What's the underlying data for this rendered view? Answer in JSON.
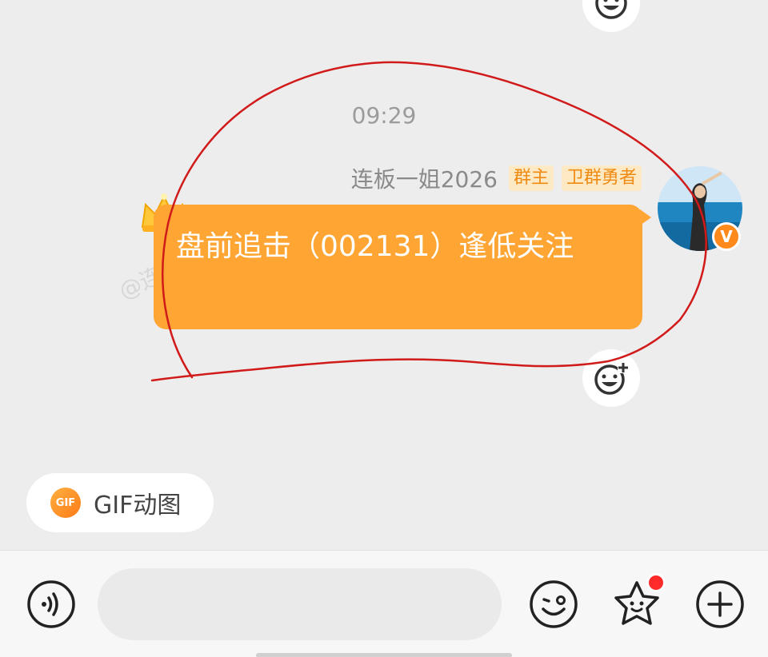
{
  "chat": {
    "timestamp": "09:29",
    "sender": {
      "name": "连板一姐2026",
      "badges": [
        "群主",
        "卫群勇者"
      ],
      "verified_mark": "V"
    },
    "message": "盘前追击（002131）逢低关注",
    "watermark": "@连板一姐2026"
  },
  "quick_actions": {
    "gif_label": "GIF动图",
    "gif_icon_text": "GIF"
  },
  "input_bar": {
    "placeholder": "",
    "icons": [
      "voice-icon",
      "emoji-icon",
      "sticker-star-icon",
      "plus-icon"
    ]
  },
  "colors": {
    "bubble": "#ffa533",
    "badge_text": "#ef8a12",
    "badge_bg": "#fde9c4",
    "annotation_stroke": "#d11a1a",
    "notification_dot": "#ff2b2b"
  }
}
